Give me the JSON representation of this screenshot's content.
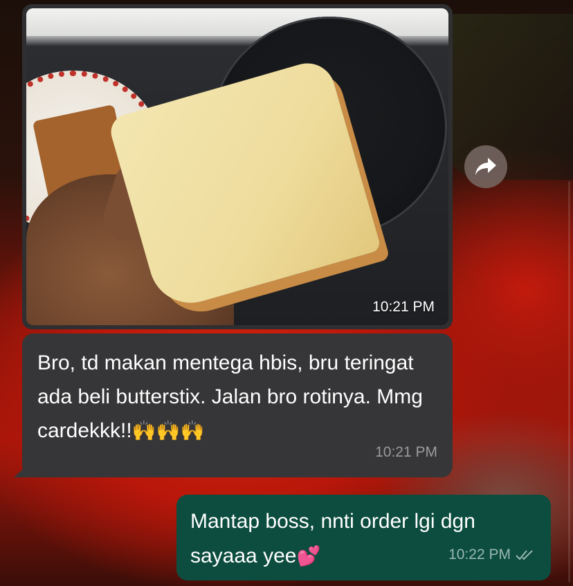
{
  "messages": [
    {
      "type": "image",
      "direction": "incoming",
      "time": "10:21 PM"
    },
    {
      "type": "text",
      "direction": "incoming",
      "text": "Bro, td makan mentega hbis, bru teringat ada beli butterstix. Jalan bro rotinya. Mmg cardekkk!!",
      "emoji": "🙌🙌🙌",
      "time": "10:21 PM"
    },
    {
      "type": "text",
      "direction": "outgoing",
      "text": "Mantap boss, nnti order lgi dgn sayaaa yee",
      "emoji": "💕",
      "time": "10:22 PM",
      "status_icon": "double-check-icon"
    }
  ],
  "icons": {
    "forward": "forward-arrow-icon"
  },
  "colors": {
    "incoming_bubble": "#363638",
    "outgoing_bubble": "#0c4d3f",
    "image_bubble": "#2f2f31"
  }
}
